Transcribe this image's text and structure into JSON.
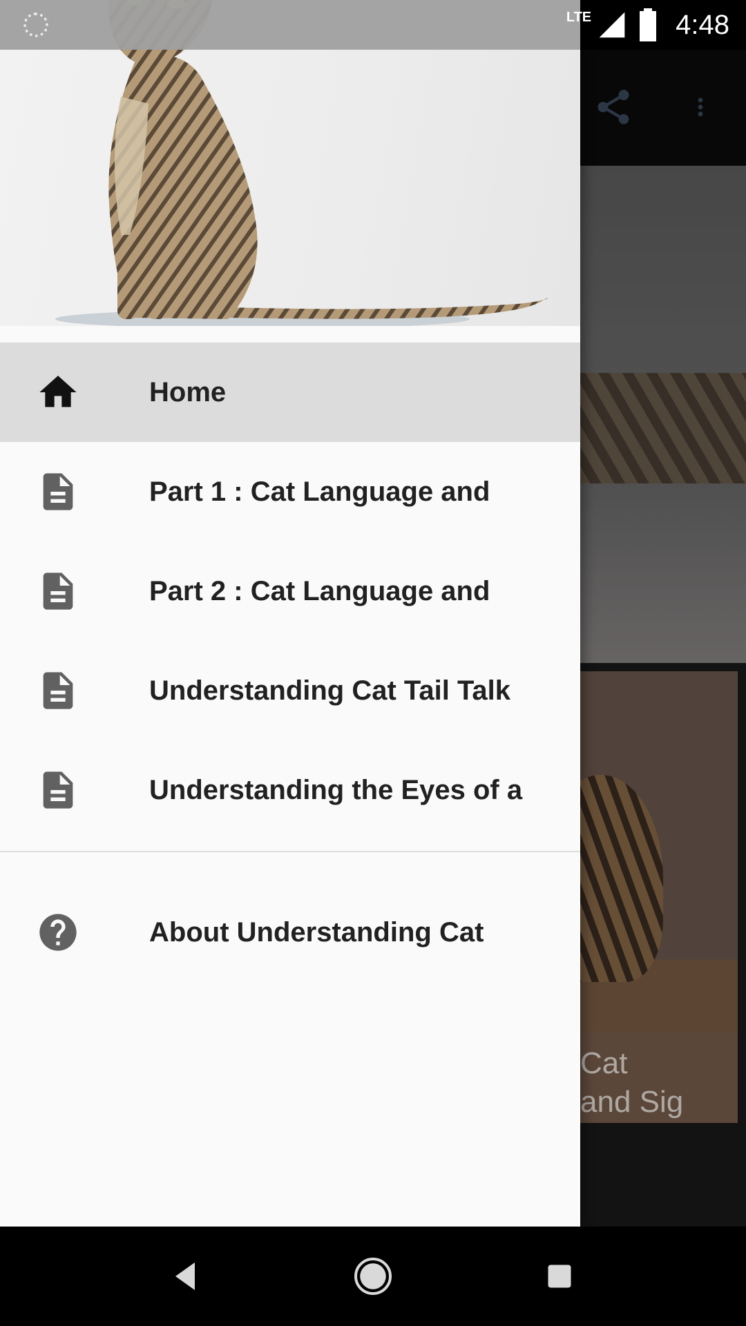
{
  "status_bar": {
    "network": "LTE",
    "time": "4:48"
  },
  "toolbar": {
    "share_icon": "share-icon",
    "more_icon": "more-vert-icon"
  },
  "background_content": {
    "card_title": "Cat\nand Sig"
  },
  "drawer": {
    "menu_items": [
      {
        "label": "Home",
        "icon": "home-icon",
        "selected": true
      },
      {
        "label": "Part 1 : Cat Language and",
        "icon": "document-icon",
        "selected": false
      },
      {
        "label": "Part 2 : Cat Language and",
        "icon": "document-icon",
        "selected": false
      },
      {
        "label": "Understanding Cat Tail Talk",
        "icon": "document-icon",
        "selected": false
      },
      {
        "label": "Understanding the Eyes of a",
        "icon": "document-icon",
        "selected": false
      }
    ],
    "secondary_items": [
      {
        "label": "About Understanding Cat",
        "icon": "help-icon"
      }
    ]
  },
  "nav_bar": {
    "back_icon": "back-icon",
    "home_icon": "home-circle-icon",
    "recents_icon": "recents-icon"
  },
  "colors": {
    "drawer_bg": "#fafafa",
    "selected_bg": "#dcdcdc",
    "icon_gray": "#616161",
    "text": "#212121"
  }
}
